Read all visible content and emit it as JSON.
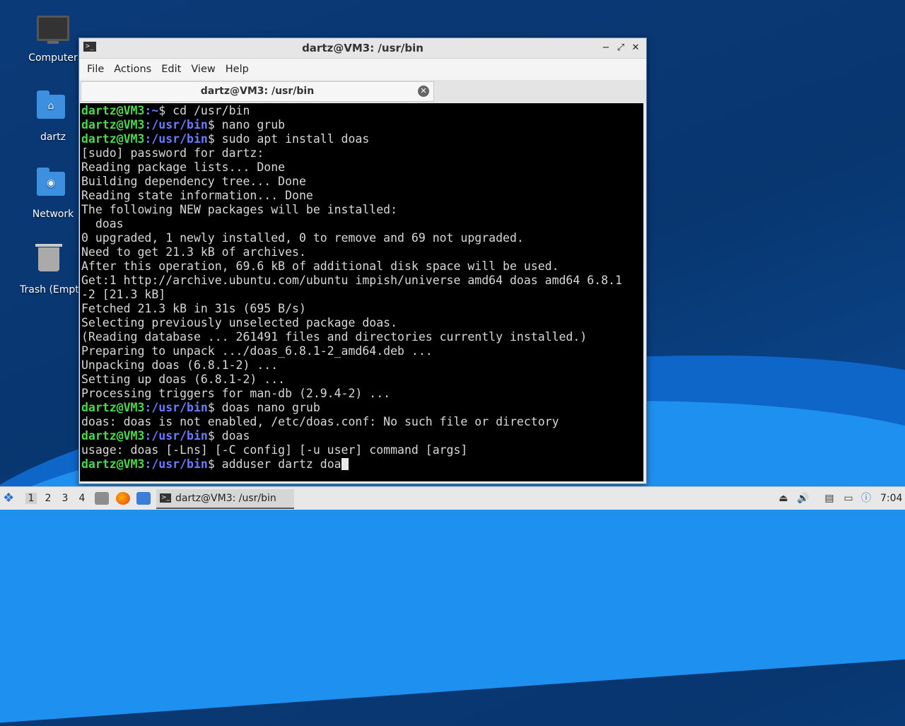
{
  "desktop": {
    "icons": [
      {
        "label": "Computer"
      },
      {
        "label": "dartz"
      },
      {
        "label": "Network"
      },
      {
        "label": "Trash (Empt"
      }
    ]
  },
  "window": {
    "title": "dartz@VM3: /usr/bin",
    "menu": [
      "File",
      "Actions",
      "Edit",
      "View",
      "Help"
    ],
    "tab_label": "dartz@VM3: /usr/bin"
  },
  "terminal": {
    "lines": [
      {
        "user": "dartz@VM3",
        "path": ":~",
        "cmd": "$ cd /usr/bin"
      },
      {
        "user": "dartz@VM3",
        "path": ":/usr/bin",
        "cmd": "$ nano grub"
      },
      {
        "user": "dartz@VM3",
        "path": ":/usr/bin",
        "cmd": "$ sudo apt install doas"
      },
      {
        "text": "[sudo] password for dartz:"
      },
      {
        "text": "Reading package lists... Done"
      },
      {
        "text": "Building dependency tree... Done"
      },
      {
        "text": "Reading state information... Done"
      },
      {
        "text": "The following NEW packages will be installed:"
      },
      {
        "text": "  doas"
      },
      {
        "text": "0 upgraded, 1 newly installed, 0 to remove and 69 not upgraded."
      },
      {
        "text": "Need to get 21.3 kB of archives."
      },
      {
        "text": "After this operation, 69.6 kB of additional disk space will be used."
      },
      {
        "text": "Get:1 http://archive.ubuntu.com/ubuntu impish/universe amd64 doas amd64 6.8.1"
      },
      {
        "text": "-2 [21.3 kB]"
      },
      {
        "text": "Fetched 21.3 kB in 31s (695 B/s)"
      },
      {
        "text": "Selecting previously unselected package doas."
      },
      {
        "text": "(Reading database ... 261491 files and directories currently installed.)"
      },
      {
        "text": "Preparing to unpack .../doas_6.8.1-2_amd64.deb ..."
      },
      {
        "text": "Unpacking doas (6.8.1-2) ..."
      },
      {
        "text": "Setting up doas (6.8.1-2) ..."
      },
      {
        "text": "Processing triggers for man-db (2.9.4-2) ..."
      },
      {
        "user": "dartz@VM3",
        "path": ":/usr/bin",
        "cmd": "$ doas nano grub"
      },
      {
        "text": "doas: doas is not enabled, /etc/doas.conf: No such file or directory"
      },
      {
        "user": "dartz@VM3",
        "path": ":/usr/bin",
        "cmd": "$ doas"
      },
      {
        "text": "usage: doas [-Lns] [-C config] [-u user] command [args]"
      },
      {
        "user": "dartz@VM3",
        "path": ":/usr/bin",
        "cmd": "$ adduser dartz doa",
        "cursor": true
      }
    ]
  },
  "taskbar": {
    "workspaces": [
      "1",
      "2",
      "3",
      "4"
    ],
    "active_task": "dartz@VM3: /usr/bin",
    "clock": "7:04"
  }
}
